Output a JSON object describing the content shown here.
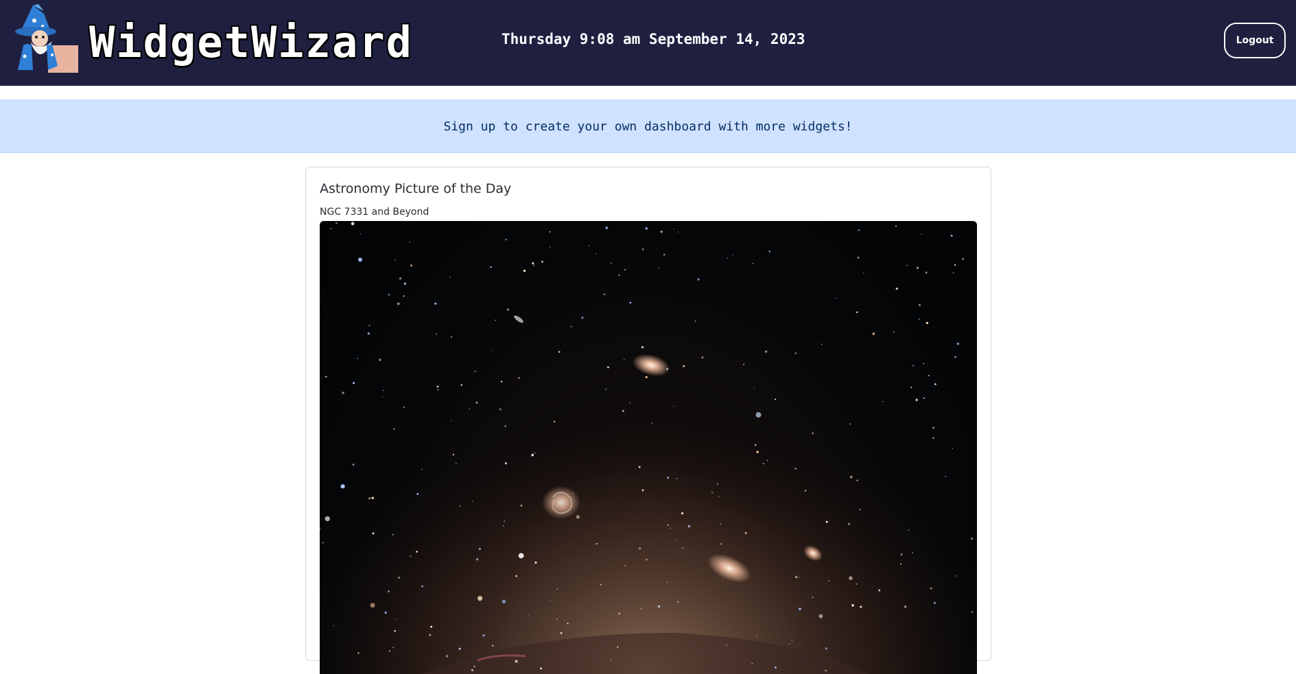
{
  "app": {
    "name": "WidgetWizard",
    "datetime": "Thursday 9:08 am September 14, 2023",
    "logout_label": "Logout"
  },
  "banner": {
    "text": "Sign up to create your own dashboard with more widgets!"
  },
  "apod": {
    "widget_title": "Astronomy Picture of the Day",
    "image_title": "NGC 7331 and Beyond"
  },
  "icons": {
    "logo": "wizard-mascot-icon"
  },
  "colors": {
    "header_bg": "#1f2040",
    "banner_bg": "#cfe2ff",
    "banner_text": "#052c65"
  }
}
